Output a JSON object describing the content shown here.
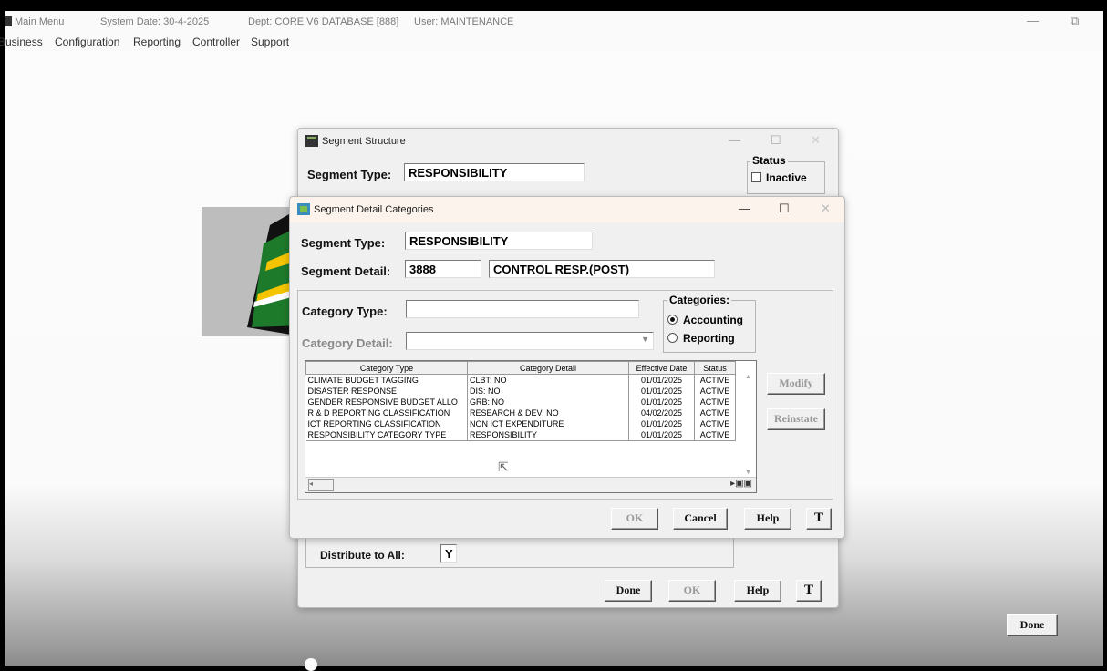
{
  "app": {
    "title": "Main Menu",
    "system_date": "System Date: 30-4-2025",
    "dept": "Dept: CORE V6 DATABASE [888]",
    "user": "User: MAINTENANCE",
    "minimize": "—",
    "restore": "⧉"
  },
  "menu": [
    "Business",
    "Configuration",
    "Reporting",
    "Controller",
    "Support"
  ],
  "segment_structure": {
    "title": "Segment Structure",
    "segment_type_label": "Segment Type:",
    "segment_type_value": "RESPONSIBILITY",
    "status_legend": "Status",
    "inactive_label": "Inactive",
    "distribute_label": "Distribute to All:",
    "distribute_value": "Y",
    "buttons": {
      "done": "Done",
      "ok": "OK",
      "help": "Help",
      "t": "T"
    }
  },
  "detail_categories": {
    "title": "Segment Detail Categories",
    "segment_type_label": "Segment Type:",
    "segment_type_value": "RESPONSIBILITY",
    "segment_detail_label": "Segment Detail:",
    "segment_detail_code": "3888",
    "segment_detail_name": "CONTROL RESP.(POST)",
    "category_type_label": "Category Type:",
    "category_type_value": "",
    "category_detail_label": "Category Detail:",
    "category_detail_value": "",
    "categories_legend": "Categories:",
    "radio_accounting": "Accounting",
    "radio_reporting": "Reporting",
    "selected_category": "Accounting",
    "columns": [
      "Category Type",
      "Category Detail",
      "Effective Date",
      "Status"
    ],
    "rows": [
      [
        "CLIMATE BUDGET TAGGING",
        "CLBT: NO",
        "01/01/2025",
        "ACTIVE"
      ],
      [
        "DISASTER RESPONSE",
        "DIS: NO",
        "01/01/2025",
        "ACTIVE"
      ],
      [
        "GENDER RESPONSIVE BUDGET ALLO",
        "GRB: NO",
        "01/01/2025",
        "ACTIVE"
      ],
      [
        "R & D REPORTING CLASSIFICATION",
        "RESEARCH & DEV: NO",
        "04/02/2025",
        "ACTIVE"
      ],
      [
        "ICT REPORTING CLASSIFICATION",
        "NON ICT EXPENDITURE",
        "01/01/2025",
        "ACTIVE"
      ],
      [
        "RESPONSIBILITY CATEGORY TYPE",
        "RESPONSIBILITY",
        "01/01/2025",
        "ACTIVE"
      ]
    ],
    "buttons": {
      "modify": "Modify",
      "reinstate": "Reinstate",
      "ok": "OK",
      "cancel": "Cancel",
      "help": "Help",
      "t": "T"
    }
  },
  "main_done": "Done"
}
